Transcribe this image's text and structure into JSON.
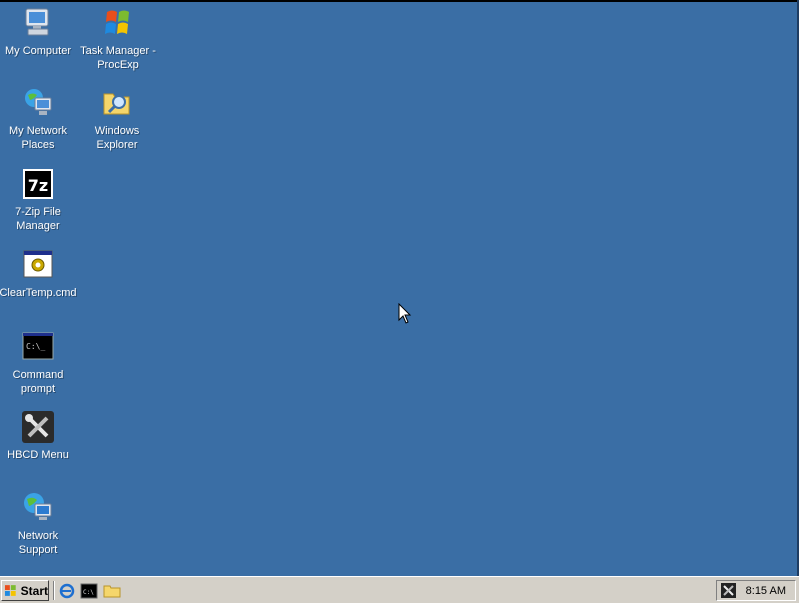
{
  "desktop": {
    "icons": [
      {
        "label": "My Computer"
      },
      {
        "label": "Task Manager - ProcExp"
      },
      {
        "label": "My Network Places"
      },
      {
        "label": "Windows Explorer"
      },
      {
        "label": "7-Zip File Manager"
      },
      {
        "label": "ClearTemp.cmd"
      },
      {
        "label": "Command prompt"
      },
      {
        "label": "HBCD Menu"
      },
      {
        "label": "Network Support"
      }
    ],
    "background_color": "#3a6ea5"
  },
  "taskbar": {
    "start_label": "Start",
    "clock": "8:15 AM",
    "quick_launch": [
      "internet-explorer-icon",
      "command-prompt-icon",
      "windows-explorer-icon"
    ]
  }
}
